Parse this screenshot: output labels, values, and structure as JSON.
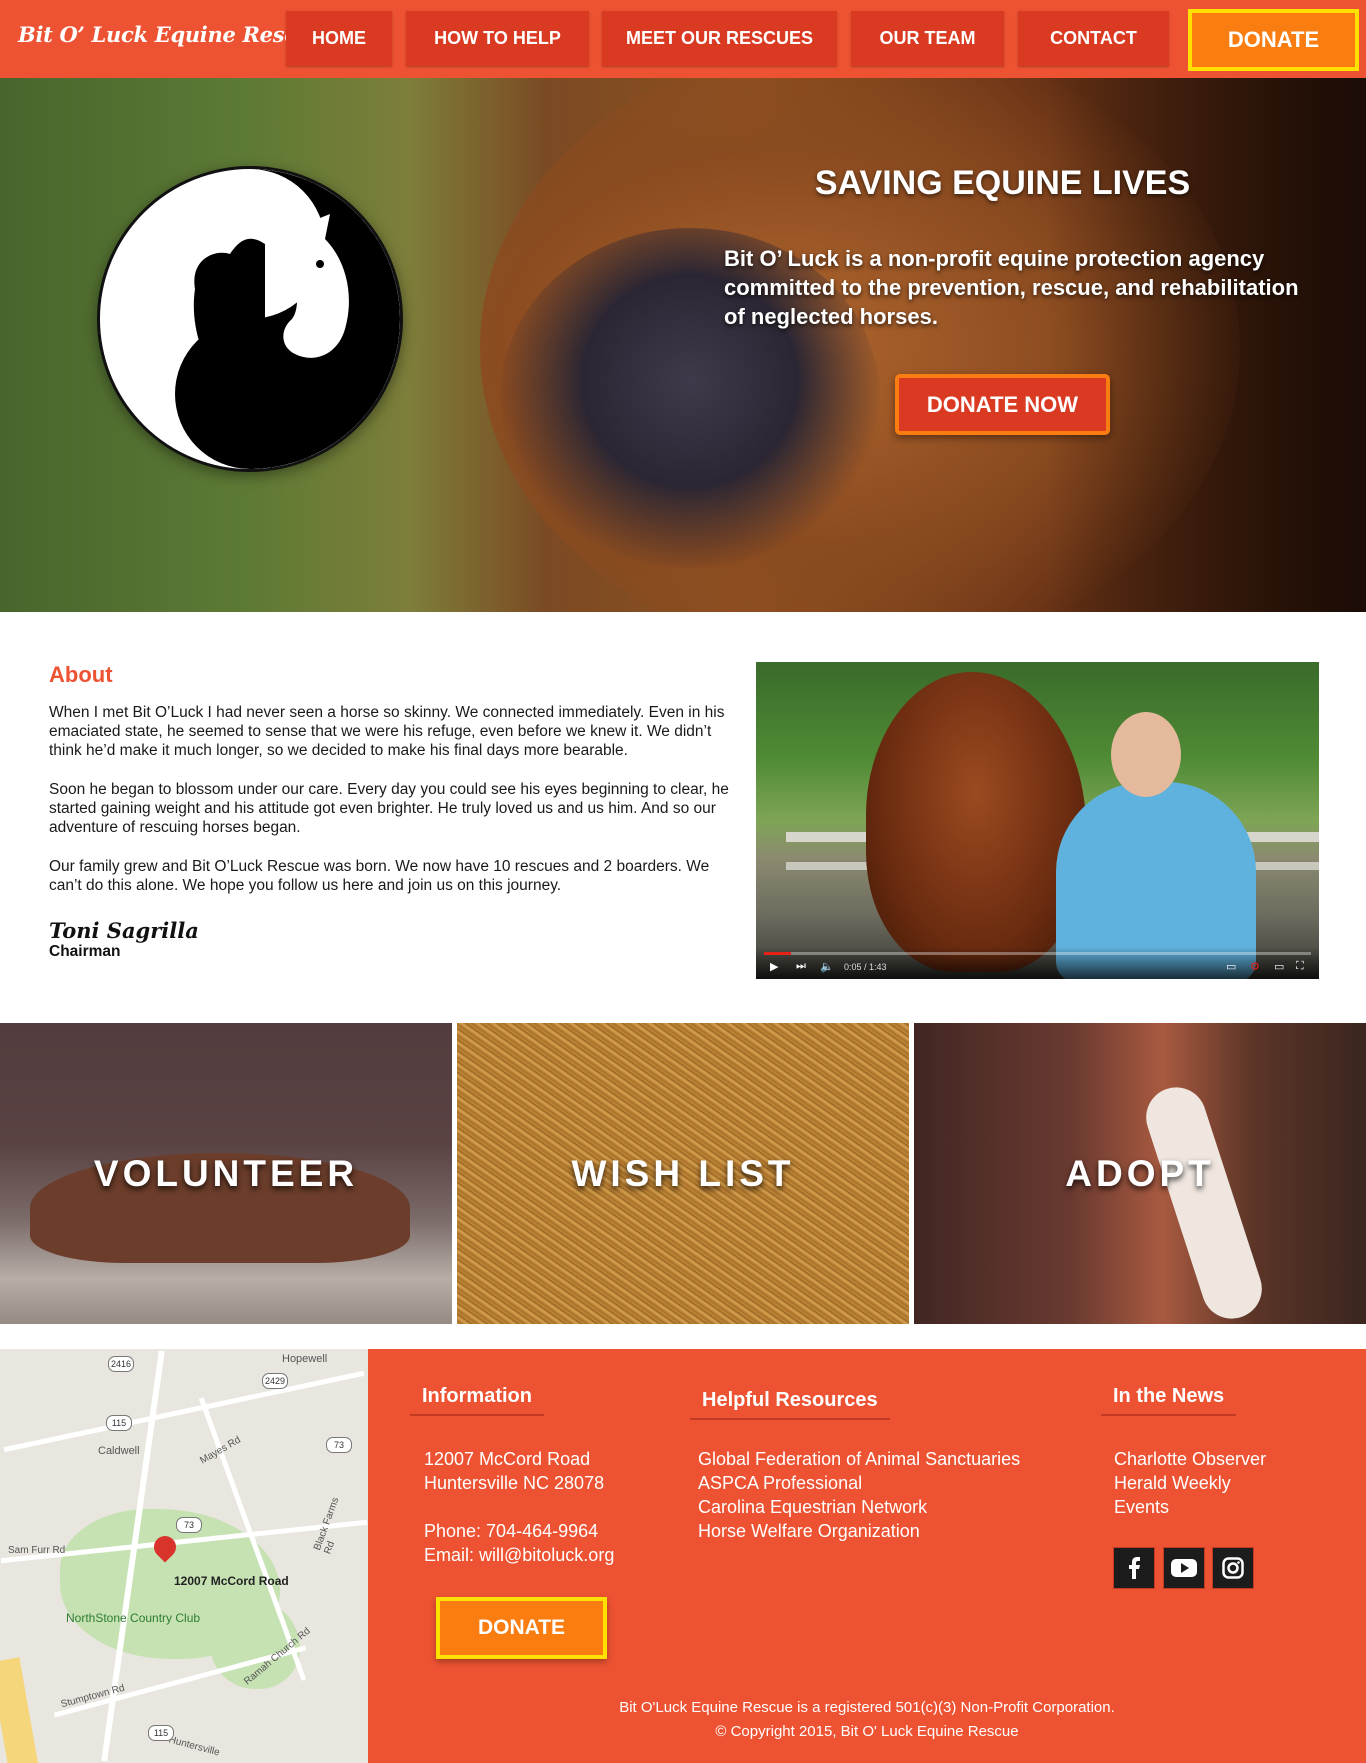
{
  "nav": {
    "logo": "Bit O’ Luck Equine Rescue",
    "items": [
      "HOME",
      "HOW TO HELP",
      "MEET OUR RESCUES",
      "OUR TEAM",
      "CONTACT"
    ],
    "donate": "DONATE"
  },
  "hero": {
    "title": "SAVING EQUINE LIVES",
    "text": "Bit O’ Luck is a non-profit equine protection agency committed to the prevention, rescue, and rehabilitation of neglected horses.",
    "cta": "DONATE NOW"
  },
  "about": {
    "heading": "About",
    "paragraphs": [
      "When I met Bit O’Luck I had never seen a horse so skinny. We connected immediately. Even in his emaciated state, he seemed to sense that we were his refuge, even before we knew it. We didn’t think he’d make it much longer, so we decided to make his final days more bearable.",
      "Soon he began to blossom under our care. Every day you could see his eyes beginning to clear, he started gaining weight and his attitude got even brighter. He truly loved us and us him. And so our adventure of rescuing horses began.",
      "Our family grew and Bit O’Luck Rescue was born. We now have 10 rescues and 2 boarders. We can’t do this alone. We hope you follow us here and join us on this journey."
    ],
    "signature": "Toni Sagrilla",
    "role": "Chairman"
  },
  "video": {
    "time": "0:05 / 1:43",
    "progress_fraction": 0.05
  },
  "tiles": [
    "VOLUNTEER",
    "WISH LIST",
    "ADOPT"
  ],
  "map": {
    "address_label": "12007 McCord Road",
    "places": [
      "Hopewell",
      "Caldwell",
      "Sam Furr Rd",
      "NorthStone Country Club",
      "Stumptown Rd",
      "Mayes Rd",
      "Black Farms Rd",
      "Ramah Church Rd",
      "Huntersville"
    ],
    "shields": [
      "2416",
      "2429",
      "115",
      "73",
      "73",
      "115"
    ]
  },
  "footer": {
    "info": {
      "heading": "Information",
      "address1": "12007 McCord Road",
      "address2": "Huntersville NC 28078",
      "phone": "Phone: 704-464-9964",
      "email": "Email: will@bitoluck.org",
      "donate": "DONATE"
    },
    "resources": {
      "heading": "Helpful Resources",
      "links": [
        "Global Federation of Animal Sanctuaries",
        "ASPCA Professional",
        "Carolina Equestrian Network",
        "Horse Welfare Organization"
      ]
    },
    "news": {
      "heading": "In the News",
      "links": [
        "Charlotte Observer",
        "Herald Weekly",
        "Events"
      ]
    },
    "social_icons": [
      "facebook-icon",
      "youtube-icon",
      "instagram-icon"
    ],
    "legal": "Bit O'Luck Equine Rescue is a registered 501(c)(3) Non-Profit Corporation.",
    "copyright": "© Copyright 2015, Bit O' Luck Equine Rescue"
  },
  "colors": {
    "brand": "#ed5332",
    "nav_button": "#db3a22",
    "donate": "#f97d11",
    "donate_border": "#ffe100"
  }
}
